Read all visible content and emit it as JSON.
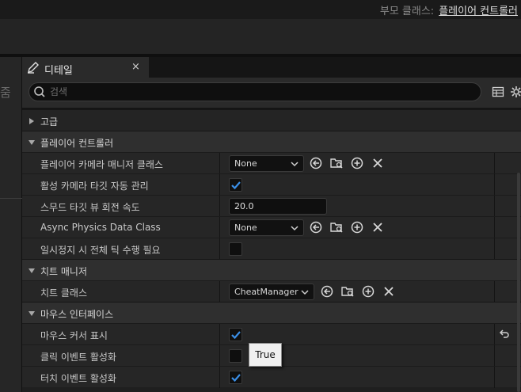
{
  "top_bar": {
    "parent_class_label": "부모 클래스:",
    "parent_class_value": "플레이어 컨트롤러"
  },
  "left_panel": {
    "cut_text": "줌"
  },
  "details_tab": {
    "title": "디테일",
    "close": "×"
  },
  "search": {
    "placeholder": "검색",
    "value": ""
  },
  "categories": {
    "advanced": "고급",
    "player_controller": "플레이어 컨트롤러",
    "cheat_manager": "치트 매니저",
    "mouse_interface": "마우스 인터페이스"
  },
  "properties": {
    "camera_manager_class": {
      "label": "플레이어 카메라 매니저 클래스",
      "value": "None"
    },
    "auto_manage_camera_target": {
      "label": "활성 카메라 타깃 자동 관리",
      "checked": true
    },
    "smooth_target_view_rotation": {
      "label": "스무드 타깃 뷰 회전 속도",
      "value": "20.0"
    },
    "async_physics_data_class": {
      "label": "Async Physics Data Class",
      "value": "None"
    },
    "should_perform_full_tick_when_paused": {
      "label": "일시정지 시 전체 틱 수행 필요",
      "checked": false
    },
    "cheat_class": {
      "label": "치트 클래스",
      "value": "CheatManager"
    },
    "show_mouse_cursor": {
      "label": "마우스 커서 표시",
      "checked": true
    },
    "enable_click_events": {
      "label": "클릭 이벤트 활성화",
      "checked": false
    },
    "enable_touch_events": {
      "label": "터치 이벤트 활성화",
      "checked": true
    }
  },
  "tooltip": {
    "text": "True"
  },
  "colors": {
    "accent_check": "#3a8ee6",
    "panel_bg": "#262626",
    "category_bg": "#2f2f2f"
  }
}
